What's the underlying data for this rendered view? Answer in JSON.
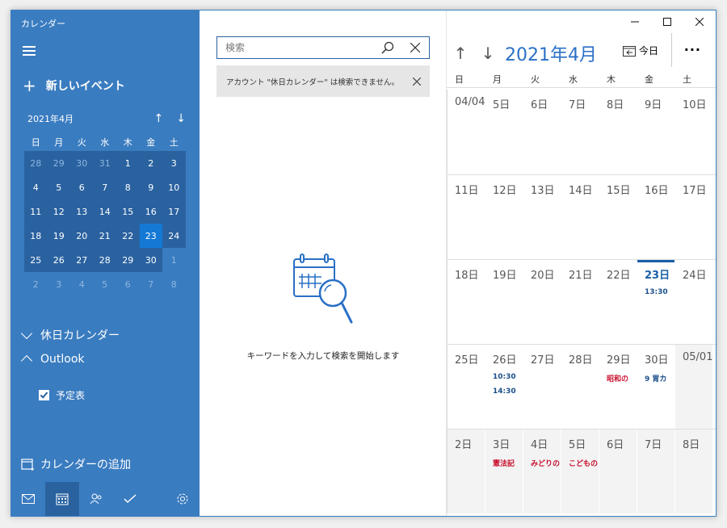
{
  "app": {
    "title": "カレンダー"
  },
  "sidebar": {
    "new_event_label": "新しいイベント",
    "mini_month": "2021年4月",
    "weekdays": [
      "日",
      "月",
      "火",
      "水",
      "木",
      "金",
      "土"
    ],
    "mini_weeks": [
      [
        "28",
        "29",
        "30",
        "31",
        "1",
        "2",
        "3"
      ],
      [
        "4",
        "5",
        "6",
        "7",
        "8",
        "9",
        "10"
      ],
      [
        "11",
        "12",
        "13",
        "14",
        "15",
        "16",
        "17"
      ],
      [
        "18",
        "19",
        "20",
        "21",
        "22",
        "23",
        "24"
      ],
      [
        "25",
        "26",
        "27",
        "28",
        "29",
        "30",
        "1"
      ],
      [
        "2",
        "3",
        "4",
        "5",
        "6",
        "7",
        "8"
      ]
    ],
    "holiday_section": "休日カレンダー",
    "outlook_section": "Outlook",
    "calendar_item": "予定表",
    "add_calendar": "カレンダーの追加"
  },
  "search": {
    "placeholder": "検索",
    "notice": "アカウント \"休日カレンダー\" は検索できません。",
    "empty_message": "キーワードを入力して検索を開始します"
  },
  "calendar": {
    "month_title": "2021年4月",
    "today_label": "今日",
    "more_label": "···",
    "weekdays": [
      "日",
      "月",
      "火",
      "水",
      "木",
      "金",
      "土"
    ],
    "weeks": [
      [
        {
          "d": "04/04"
        },
        {
          "d": "5日"
        },
        {
          "d": "6日"
        },
        {
          "d": "7日"
        },
        {
          "d": "8日"
        },
        {
          "d": "9日"
        },
        {
          "d": "10日"
        }
      ],
      [
        {
          "d": "11日"
        },
        {
          "d": "12日"
        },
        {
          "d": "13日"
        },
        {
          "d": "14日"
        },
        {
          "d": "15日"
        },
        {
          "d": "16日"
        },
        {
          "d": "17日"
        }
      ],
      [
        {
          "d": "18日"
        },
        {
          "d": "19日"
        },
        {
          "d": "20日"
        },
        {
          "d": "21日"
        },
        {
          "d": "22日"
        },
        {
          "d": "23日",
          "today": true,
          "events": [
            {
              "t": "13:30",
              "c": "blue"
            }
          ]
        },
        {
          "d": "24日"
        }
      ],
      [
        {
          "d": "25日"
        },
        {
          "d": "26日",
          "events": [
            {
              "t": "10:30",
              "c": "blue"
            },
            {
              "t": "14:30",
              "c": "blue"
            }
          ]
        },
        {
          "d": "27日"
        },
        {
          "d": "28日"
        },
        {
          "d": "29日",
          "events": [
            {
              "t": "昭和の",
              "c": "red"
            }
          ]
        },
        {
          "d": "30日",
          "events": [
            {
              "t": "9 胃カ",
              "c": "blue"
            }
          ]
        },
        {
          "d": "05/01",
          "next": true
        }
      ],
      [
        {
          "d": "2日",
          "next": true
        },
        {
          "d": "3日",
          "next": true,
          "events": [
            {
              "t": "憲法記",
              "c": "red"
            }
          ]
        },
        {
          "d": "4日",
          "next": true,
          "events": [
            {
              "t": "みどりの",
              "c": "red"
            }
          ]
        },
        {
          "d": "5日",
          "next": true,
          "events": [
            {
              "t": "こどもの",
              "c": "red"
            }
          ]
        },
        {
          "d": "6日",
          "next": true
        },
        {
          "d": "7日",
          "next": true
        },
        {
          "d": "8日",
          "next": true
        }
      ]
    ]
  }
}
